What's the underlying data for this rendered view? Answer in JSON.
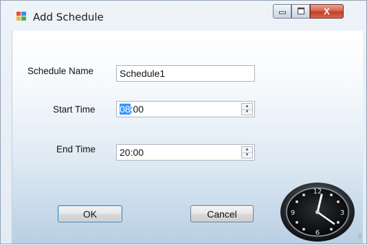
{
  "window": {
    "title": "Add Schedule",
    "minimize_label": "▭",
    "maximize_label": "▢",
    "close_label": "X"
  },
  "form": {
    "schedule_name_label": "Schedule Name",
    "schedule_name_value": "Schedule1",
    "start_time_label": "Start Time",
    "start_time_hours": "08",
    "start_time_rest": ":00",
    "end_time_label": "End Time",
    "end_time_value": "20:00"
  },
  "buttons": {
    "ok_label": "OK",
    "cancel_label": "Cancel"
  },
  "clock": {
    "icon": "analog-clock-icon",
    "numerals": [
      "12",
      "3",
      "6",
      "9"
    ]
  },
  "colors": {
    "selection": "#3399ff",
    "close_button": "#c1402a"
  }
}
